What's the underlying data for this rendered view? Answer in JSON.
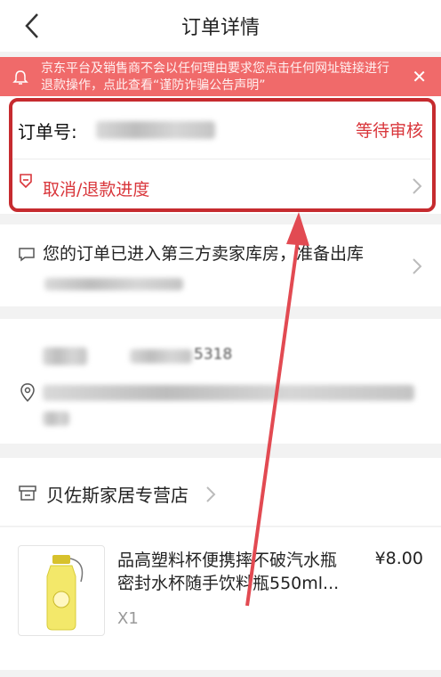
{
  "header": {
    "title": "订单详情"
  },
  "notice": {
    "text": "京东平台及销售商不会以任何理由要求您点击任何网址链接进行退款操作，点此查看“谨防诈骗公告声明”"
  },
  "order": {
    "number_label": "订单号:",
    "status": "等待审核",
    "refund_link": "取消/退款进度"
  },
  "logistics": {
    "message": "您的订单已进入第三方卖家库房，准备出库"
  },
  "address": {
    "phone_suffix": "5318"
  },
  "shop": {
    "name": "贝佐斯家居专营店"
  },
  "product": {
    "name": "品高塑料杯便携摔不破汽水瓶密封水杯随手饮料瓶550ml...",
    "price": "¥8.00",
    "quantity": "X1"
  },
  "colors": {
    "accent": "#d9363b",
    "notice_bg": "#f06a6a",
    "highlight_box": "#c62b2f"
  }
}
